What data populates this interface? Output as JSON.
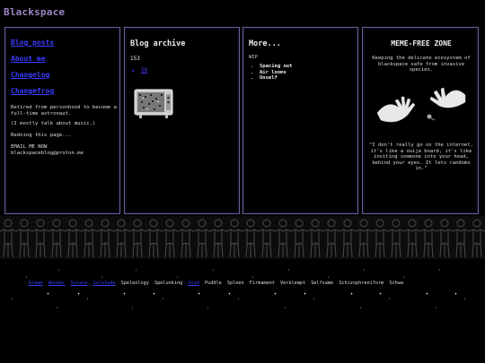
{
  "site": {
    "title": "Blackspace"
  },
  "nav": {
    "links": [
      "Blog posts",
      "About me",
      "Changelog",
      "Changefrog"
    ]
  },
  "about": {
    "bio": "Retired from personhood to become a full-time astronaut.",
    "topics": "(I mostly talk about music.)",
    "status": "Redoing this page...",
    "email": "EMAIL ME NOW blackspaceblog@proton.me"
  },
  "archive": {
    "title": "Blog archive",
    "count": "153",
    "items": [
      "56"
    ]
  },
  "more": {
    "title": "More...",
    "wip": "WIP",
    "items": [
      "Spacing out",
      "Air looms",
      "Unself"
    ]
  },
  "zone": {
    "title": "MEME-FREE ZONE",
    "description": "Keeping the delicate ecosystem of blackspace safe from invasive species.",
    "quote": "\"I don't really go on the internet, it's like a ouija board, it's like inviting someone into your head, behind your eyes. It lets randoms in.\""
  },
  "wordrow": [
    {
      "text": "Dream",
      "link": true
    },
    {
      "text": "Wonder",
      "link": true
    },
    {
      "text": "Solace",
      "link": true
    },
    {
      "text": "Solitude",
      "link": true
    },
    {
      "text": "Speleology",
      "link": false
    },
    {
      "text": "Spelunking",
      "link": false
    },
    {
      "text": "Void",
      "link": true
    },
    {
      "text": "Puddle",
      "link": false
    },
    {
      "text": "Spleen",
      "link": false
    },
    {
      "text": "Firmament",
      "link": false
    },
    {
      "text": "Verklempt",
      "link": false
    },
    {
      "text": "Selfsame",
      "link": false
    },
    {
      "text": "Schizophreniform",
      "link": false
    },
    {
      "text": "Schwa",
      "link": false
    }
  ],
  "colors": {
    "accent": "#9b86c4",
    "border": "#6f5fa0",
    "link": "#3b3bff"
  }
}
